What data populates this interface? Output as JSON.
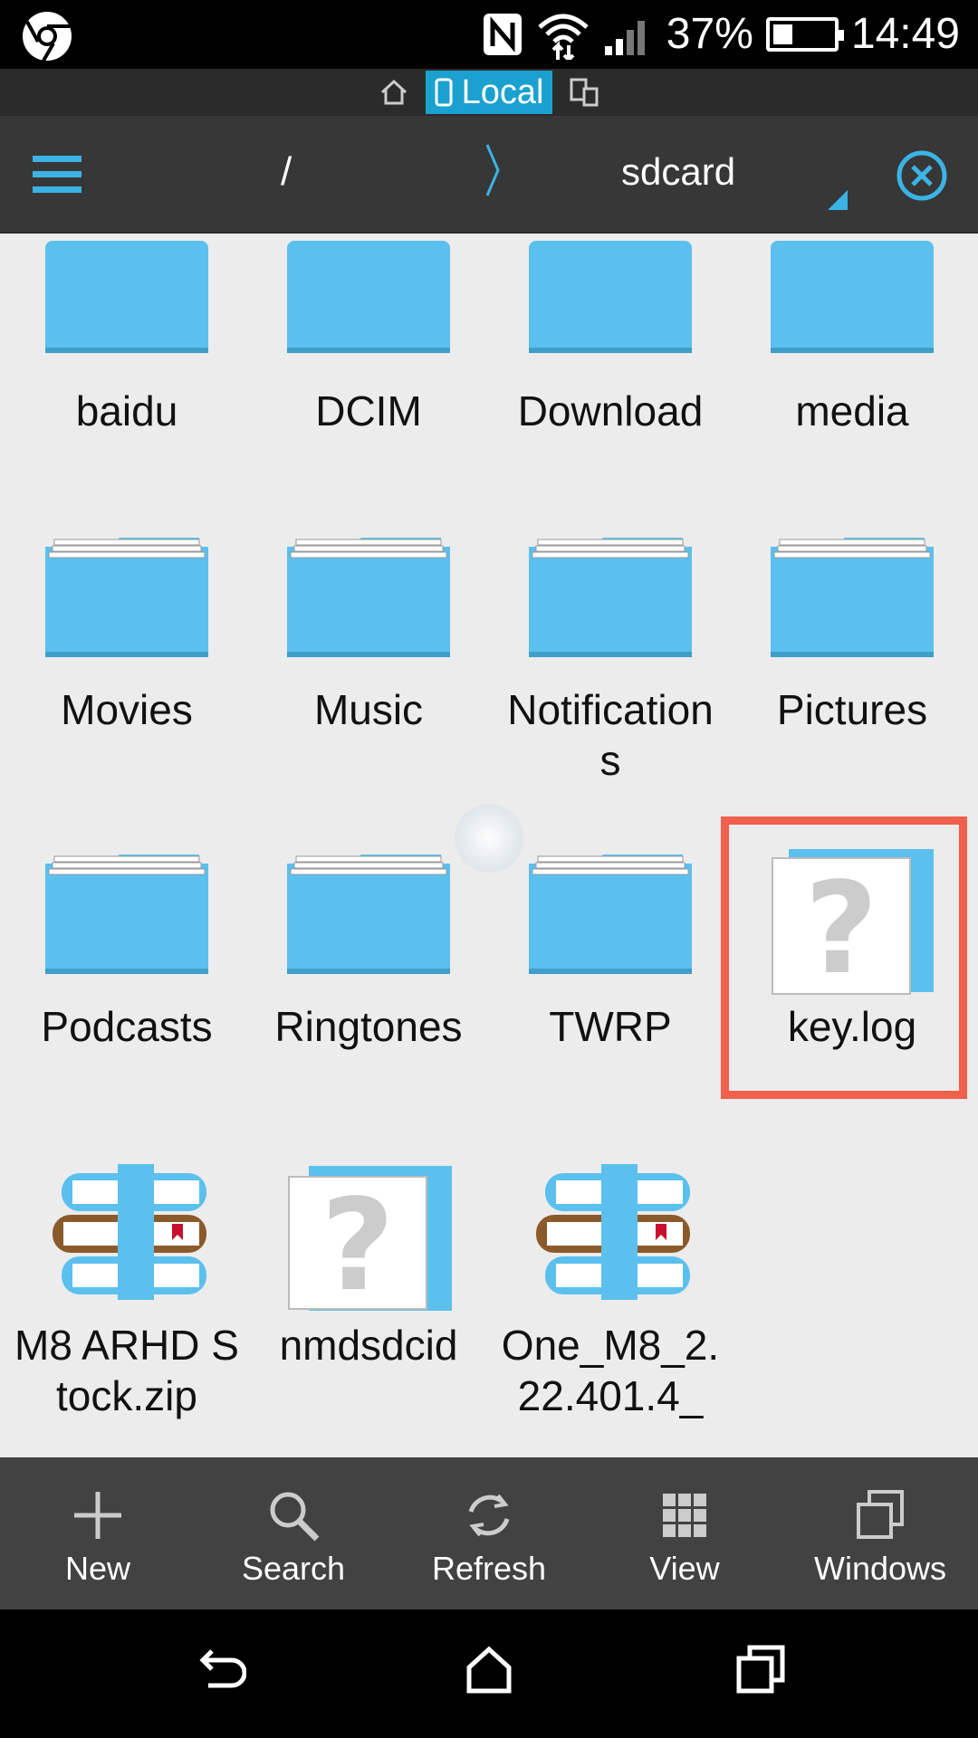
{
  "status": {
    "battery": "37%",
    "time": "14:49"
  },
  "location": {
    "local_label": "Local"
  },
  "path": {
    "root": "/",
    "current": "sdcard"
  },
  "items": [
    {
      "name": "baidu",
      "type": "folder"
    },
    {
      "name": "DCIM",
      "type": "folder"
    },
    {
      "name": "Download",
      "type": "folder"
    },
    {
      "name": "media",
      "type": "folder"
    },
    {
      "name": "Movies",
      "type": "folder"
    },
    {
      "name": "Music",
      "type": "folder"
    },
    {
      "name": "Notifications",
      "type": "folder"
    },
    {
      "name": "Pictures",
      "type": "folder"
    },
    {
      "name": "Podcasts",
      "type": "folder"
    },
    {
      "name": "Ringtones",
      "type": "folder"
    },
    {
      "name": "TWRP",
      "type": "folder"
    },
    {
      "name": "key.log",
      "type": "unknown"
    },
    {
      "name": "M8 ARHD Stock.zip",
      "type": "archive"
    },
    {
      "name": "nmdsdcid",
      "type": "unknown"
    },
    {
      "name": "One_M8_2.22.401.4_",
      "type": "archive"
    }
  ],
  "toolbar": {
    "new": "New",
    "search": "Search",
    "refresh": "Refresh",
    "view": "View",
    "windows": "Windows"
  },
  "colors": {
    "accent": "#1aa1cf",
    "folder": "#5bc0ee",
    "highlight": "#f0604c"
  }
}
